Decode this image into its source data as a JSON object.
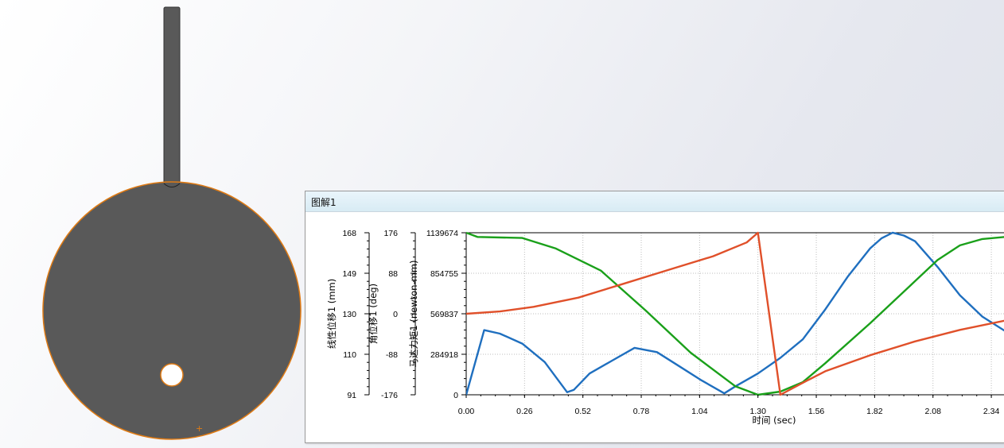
{
  "model": {
    "shaft_color": "#595959",
    "disc_color": "#595959",
    "edge_color": "#e07b14"
  },
  "plot_window": {
    "title": "图解1"
  },
  "chart_data": {
    "type": "line",
    "x": {
      "label": "时间 (sec)",
      "ticks": [
        "0.00",
        "0.26",
        "0.52",
        "0.78",
        "1.04",
        "1.30",
        "1.56",
        "1.82",
        "2.08",
        "2.34"
      ],
      "range": [
        0,
        2.4
      ]
    },
    "axes": [
      {
        "label": "线性位移1 (mm)",
        "ticks": [
          "168",
          "149",
          "130",
          "110",
          "91"
        ],
        "range": [
          91,
          168
        ]
      },
      {
        "label": "角位移1 (deg)",
        "ticks": [
          "176",
          "88",
          "0",
          "-88",
          "-176"
        ],
        "range": [
          -176,
          176
        ]
      },
      {
        "label": "马达力矩1 (newton-mm)",
        "ticks": [
          "1139674",
          "854755",
          "569837",
          "284918",
          "0"
        ],
        "range": [
          0,
          1139674
        ]
      }
    ],
    "grid": true,
    "series": [
      {
        "axis": 2,
        "color": "#1f6fbf",
        "x": [
          0.0,
          0.08,
          0.15,
          0.25,
          0.35,
          0.45,
          0.48,
          0.55,
          0.65,
          0.75,
          0.85,
          0.95,
          1.05,
          1.15,
          1.2,
          1.3,
          1.4,
          1.5,
          1.6,
          1.7,
          1.8,
          1.85,
          1.9,
          1.95,
          2.0,
          2.1,
          2.2,
          2.3,
          2.4
        ],
        "y": [
          0,
          455000,
          430000,
          360000,
          230000,
          18000,
          35000,
          150000,
          240000,
          330000,
          300000,
          200000,
          100000,
          10000,
          60000,
          150000,
          260000,
          390000,
          600000,
          830000,
          1030000,
          1100000,
          1140000,
          1120000,
          1080000,
          900000,
          700000,
          550000,
          450000
        ]
      },
      {
        "axis": 0,
        "color": "#1aa01a",
        "x": [
          0.0,
          0.05,
          0.25,
          0.4,
          0.6,
          0.8,
          1.0,
          1.2,
          1.3,
          1.4,
          1.5,
          1.6,
          1.8,
          2.0,
          2.1,
          2.2,
          2.3,
          2.4
        ],
        "y": [
          168,
          166.0,
          165.5,
          160.5,
          150.0,
          131.0,
          111.0,
          95.0,
          91.0,
          92.5,
          97.0,
          106.0,
          125.0,
          145.0,
          155.0,
          162.0,
          165.0,
          166.0
        ]
      },
      {
        "axis": 1,
        "color": "#e0502a",
        "x": [
          0.0,
          0.15,
          0.3,
          0.5,
          0.7,
          0.9,
          1.1,
          1.25,
          1.3,
          1.4,
          1.5,
          1.6,
          1.8,
          2.0,
          2.2,
          2.4
        ],
        "y": [
          0,
          5,
          15,
          35,
          65,
          95,
          125,
          155,
          176,
          -176,
          -150,
          -125,
          -90,
          -60,
          -35,
          -15
        ]
      }
    ]
  }
}
